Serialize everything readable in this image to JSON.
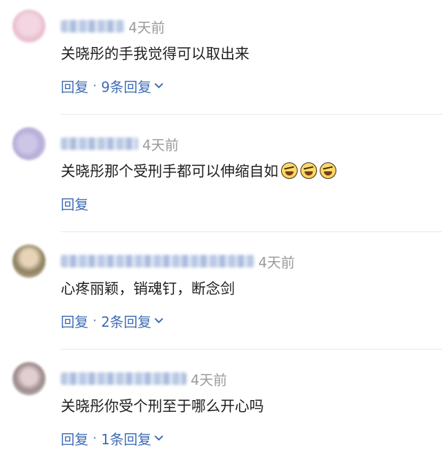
{
  "comments": [
    {
      "time": "4天前",
      "text": "关晓彤的手我觉得可以取出来",
      "emoji_count": 0,
      "reply_label": "回复",
      "replies_label": "9条回复",
      "has_replies": true
    },
    {
      "time": "4天前",
      "text": "关晓彤那个受刑手都可以伸缩自如",
      "emoji_count": 3,
      "emoji_name": "rolling-on-floor-laughing-emoji",
      "reply_label": "回复",
      "replies_label": "",
      "has_replies": false
    },
    {
      "time": "4天前",
      "text": "心疼丽颖，销魂钉，断念剑",
      "emoji_count": 0,
      "reply_label": "回复",
      "replies_label": "2条回复",
      "has_replies": true
    },
    {
      "time": "4天前",
      "text": "关晓彤你受个刑至于哪么开心吗",
      "emoji_count": 0,
      "reply_label": "回复",
      "replies_label": "1条回复",
      "has_replies": true
    }
  ],
  "separator": "·",
  "colors": {
    "link": "#3e6cb4",
    "timestamp": "#9a9a9a",
    "text": "#1f1f1f",
    "divider": "#e6e6e6"
  }
}
